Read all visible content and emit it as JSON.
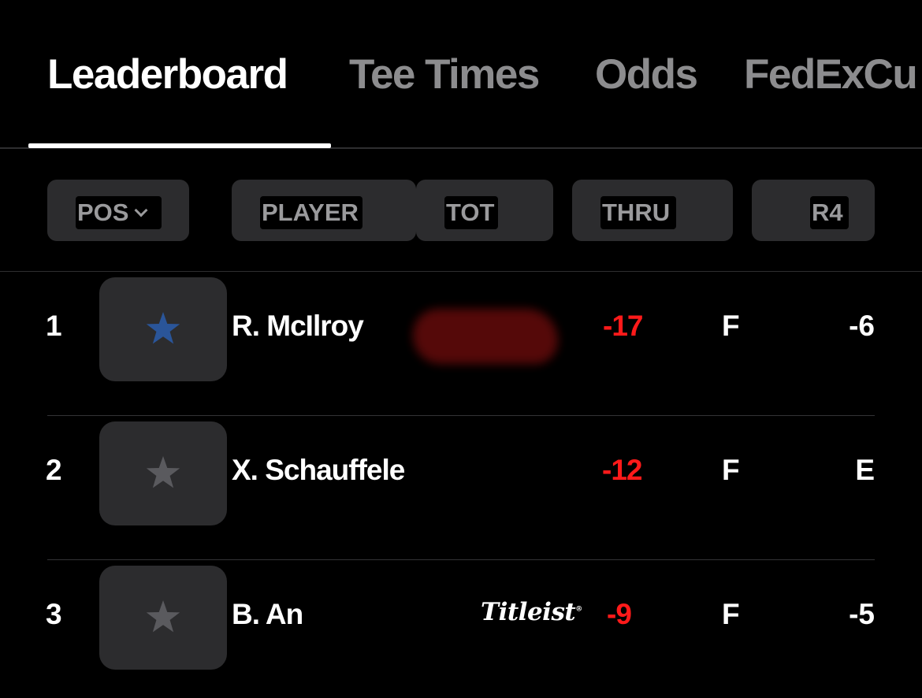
{
  "tabs": [
    {
      "label": "Leaderboard",
      "active": true
    },
    {
      "label": "Tee Times",
      "active": false
    },
    {
      "label": "Odds",
      "active": false
    },
    {
      "label": "FedExCu",
      "active": false
    }
  ],
  "columns": {
    "pos": "POS",
    "player": "PLAYER",
    "tot": "TOT",
    "thru": "THRU",
    "r4": "R4"
  },
  "rows": [
    {
      "pos": "1",
      "player": "R. McIlroy",
      "tot": "-17",
      "thru": "F",
      "r4": "-6",
      "favorite": true,
      "star_color": "#2a5599",
      "sponsor": "redacted"
    },
    {
      "pos": "2",
      "player": "X. Schauffele",
      "tot": "-12",
      "thru": "F",
      "r4": "E",
      "favorite": false,
      "star_color": "#5a5a5e",
      "sponsor": ""
    },
    {
      "pos": "3",
      "player": "B. An",
      "tot": "-9",
      "thru": "F",
      "r4": "-5",
      "favorite": false,
      "star_color": "#5a5a5e",
      "sponsor": "Titleist"
    }
  ],
  "colors": {
    "background": "#000000",
    "score_under_par": "#ff1a1a",
    "inactive_tab": "#8c8c8e",
    "button_bg": "#2c2c2e"
  },
  "icons": {
    "favorite": "star-icon",
    "sort": "chevron-down-icon"
  }
}
